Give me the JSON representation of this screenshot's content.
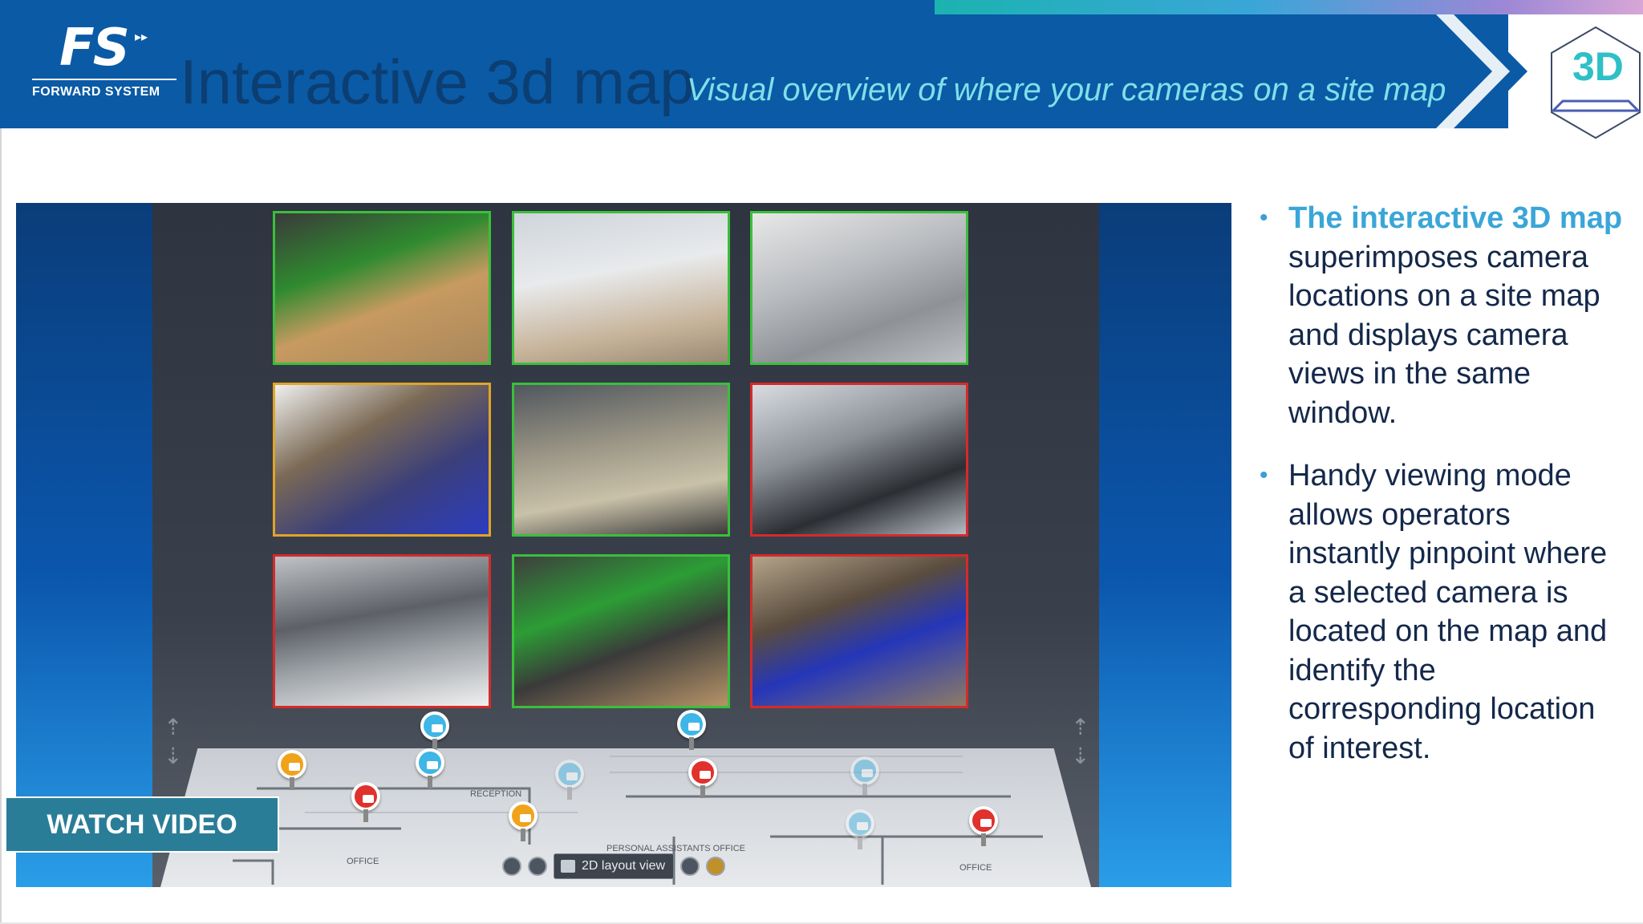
{
  "header": {
    "logo_mark": "FS",
    "logo_text": "FORWARD SYSTEM",
    "title": "Interactive 3d map",
    "subtitle": "Visual overview of where your cameras on a site map",
    "badge": "3D"
  },
  "viewer": {
    "toolbar_label": "2D layout view",
    "cameras": [
      {
        "border": "green",
        "scene": "studio"
      },
      {
        "border": "green",
        "scene": "lobby"
      },
      {
        "border": "green",
        "scene": "parking"
      },
      {
        "border": "orange",
        "scene": "warehouse"
      },
      {
        "border": "green",
        "scene": "hall"
      },
      {
        "border": "red",
        "scene": "entrance"
      },
      {
        "border": "red",
        "scene": "parking-2"
      },
      {
        "border": "green",
        "scene": "studio-2"
      },
      {
        "border": "red",
        "scene": "storage"
      }
    ],
    "floor_labels": [
      "RECEPTION",
      "OFFICE",
      "PERSONAL ASSISTANTS OFFICE",
      "OFFICE"
    ]
  },
  "watch_button": "WATCH VIDEO",
  "bullets": [
    {
      "highlight": "The interactive 3D map",
      "text": " superimposes camera locations on a site map and displays camera views in the same window."
    },
    {
      "highlight": "",
      "text": "Handy viewing mode allows operators instantly pinpoint where a selected camera is located on the map and identify the corresponding location of interest."
    }
  ],
  "colors": {
    "header_blue": "#0a5aa6",
    "title_dark": "#0c3e72",
    "subtitle_cyan": "#7fe0e8",
    "accent_teal": "#3aa6d8",
    "watch_button": "#2a7d97"
  }
}
